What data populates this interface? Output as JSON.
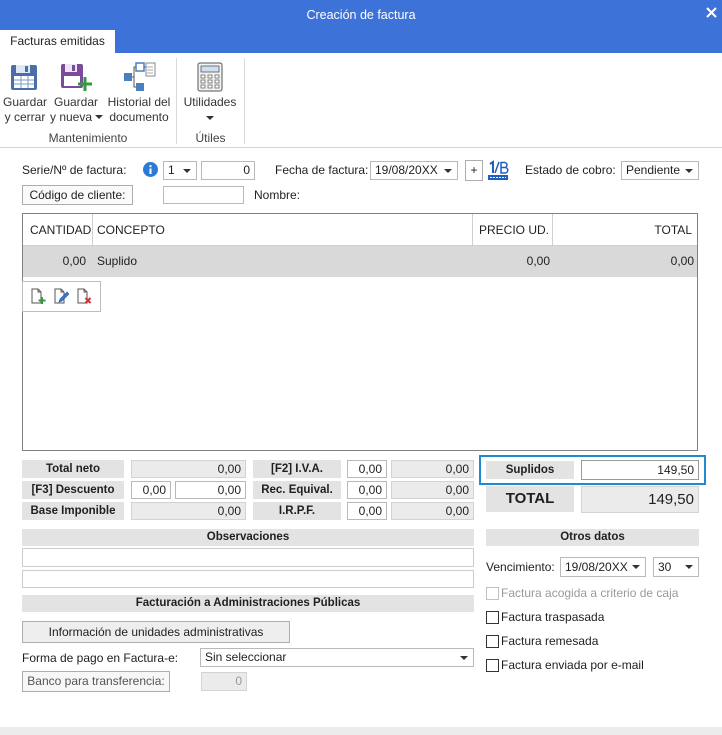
{
  "window": {
    "title": "Creación de factura"
  },
  "colors": {
    "accent": "#3d72d9",
    "highlight_border": "#1f8ad2",
    "selected_row": "#d9d9d9"
  },
  "tabs": [
    {
      "label": "Facturas emitidas",
      "active": true
    }
  ],
  "ribbon": {
    "groups": [
      {
        "label": "Mantenimiento",
        "buttons": [
          {
            "line1": "Guardar",
            "line2": "y cerrar",
            "icon": "save-close-icon"
          },
          {
            "line1": "Guardar",
            "line2": "y nueva",
            "icon": "save-new-icon",
            "has_dropdown": true
          },
          {
            "line1": "Historial del",
            "line2": "documento",
            "icon": "document-history-icon"
          }
        ]
      },
      {
        "label": "Útiles",
        "buttons": [
          {
            "line1": "Utilidades",
            "icon": "utilities-icon",
            "has_dropdown": true
          }
        ]
      }
    ]
  },
  "header": {
    "serie_label": "Serie/Nº de factura:",
    "serie_value": "1",
    "numero_value": "0",
    "fecha_label": "Fecha de factura:",
    "fecha_value": "19/08/20XX",
    "add_date_label": "+",
    "estado_label": "Estado de cobro:",
    "estado_value": "Pendiente",
    "cliente_button": "Código de cliente:",
    "cliente_value": "",
    "nombre_label": "Nombre:"
  },
  "table": {
    "columns": [
      "CANTIDAD",
      "CONCEPTO",
      "PRECIO UD.",
      "TOTAL"
    ],
    "rows": [
      {
        "cantidad": "0,00",
        "concepto": "Suplido",
        "precio": "0,00",
        "total": "0,00",
        "selected": true
      }
    ],
    "toolbar_icons": [
      "add-line-icon",
      "edit-line-icon",
      "delete-line-icon"
    ]
  },
  "totals": {
    "total_neto_label": "Total neto",
    "total_neto_value": "0,00",
    "descuento_label": "[F3] Descuento",
    "descuento_pct": "0,00",
    "descuento_value": "0,00",
    "base_label": "Base Imponible",
    "base_value": "0,00",
    "iva_label": "[F2] I.V.A.",
    "iva_pct": "0,00",
    "iva_value": "0,00",
    "rec_label": "Rec. Equival.",
    "rec_pct": "0,00",
    "rec_value": "0,00",
    "irpf_label": "I.R.P.F.",
    "irpf_pct": "0,00",
    "irpf_value": "0,00",
    "suplidos_label": "Suplidos",
    "suplidos_value": "149,50",
    "total_label": "TOTAL",
    "total_value": "149,50"
  },
  "observaciones": {
    "header": "Observaciones",
    "lines": [
      "",
      ""
    ]
  },
  "aapp": {
    "header": "Facturación a Administraciones Públicas",
    "units_button": "Información de unidades administrativas",
    "forma_pago_label": "Forma de pago en Factura-e:",
    "forma_pago_value": "Sin seleccionar",
    "banco_button": "Banco para transferencia:",
    "banco_value": "0"
  },
  "otros_datos": {
    "header": "Otros datos",
    "vencimiento_label": "Vencimiento:",
    "vencimiento_value": "19/08/20XX",
    "dias_value": "30",
    "checkboxes": [
      {
        "label": "Factura acogida a criterio de caja",
        "checked": false,
        "disabled": true
      },
      {
        "label": "Factura traspasada",
        "checked": false,
        "disabled": false
      },
      {
        "label": "Factura remesada",
        "checked": false,
        "disabled": false
      },
      {
        "label": "Factura enviada por e-mail",
        "checked": false,
        "disabled": false
      }
    ]
  }
}
